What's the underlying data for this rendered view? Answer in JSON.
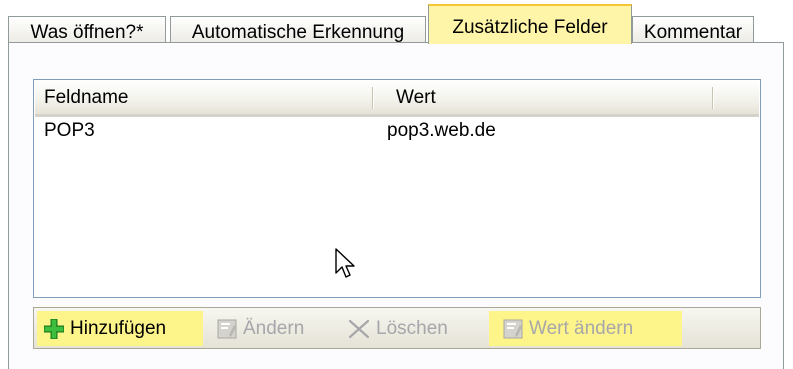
{
  "tabs": [
    {
      "label": "Was öffnen?*",
      "selected": false
    },
    {
      "label": "Automatische Erkennung",
      "selected": false
    },
    {
      "label": "Zusätzliche Felder",
      "selected": true
    },
    {
      "label": "Kommentar",
      "selected": false
    }
  ],
  "list": {
    "columns": [
      "Feldname",
      "Wert"
    ],
    "rows": [
      {
        "feldname": "POP3",
        "wert": "pop3.web.de"
      }
    ]
  },
  "toolbar": {
    "add_label": "Hinzufügen",
    "edit_label": "Ändern",
    "delete_label": "Löschen",
    "edit_value_label": "Wert ändern"
  },
  "colors": {
    "highlight": "#fdf48a",
    "selected_tab": "#fff5a9",
    "add_icon": "#2fa12f",
    "disabled_text": "#a7a6aa"
  }
}
